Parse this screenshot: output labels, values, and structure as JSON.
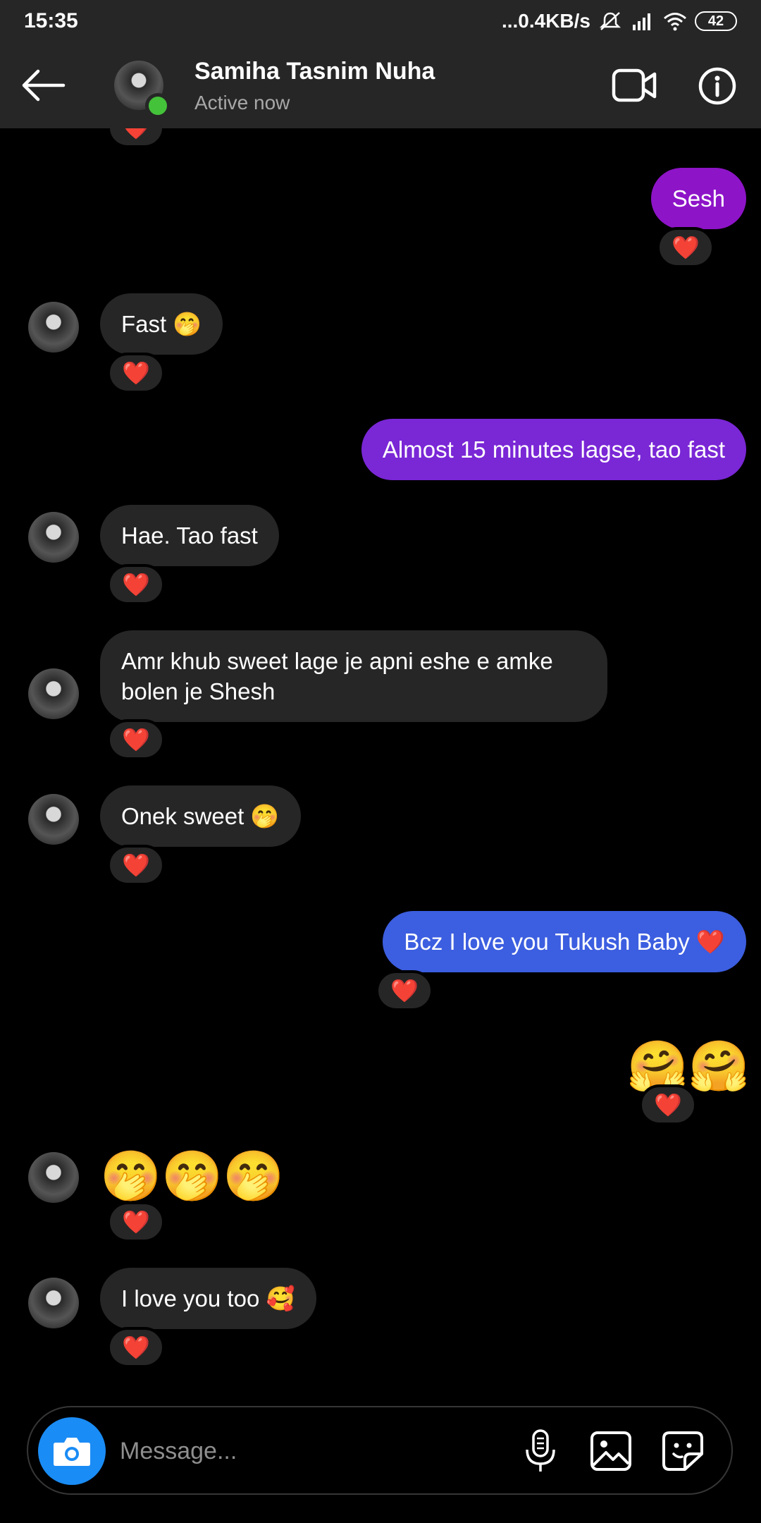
{
  "status_bar": {
    "time": "15:35",
    "network_speed": "...0.4KB/s",
    "battery": "42"
  },
  "header": {
    "back_icon": "arrow-left-icon",
    "contact_name": "Samiha Tasnim Nuha",
    "contact_status": "Active now",
    "video_icon": "video-call-icon",
    "info_icon": "info-icon"
  },
  "messages": [
    {
      "side": "out",
      "text": "Sesh",
      "color": "#8e14c8",
      "reaction": "❤️"
    },
    {
      "side": "in",
      "text": "Fast 🤭",
      "reaction": "❤️"
    },
    {
      "side": "out",
      "text": "Almost 15 minutes lagse, tao fast",
      "color": "#7a27d6"
    },
    {
      "side": "in",
      "text": "Hae. Tao fast",
      "reaction": "❤️"
    },
    {
      "side": "in",
      "text": "Amr khub sweet lage je apni eshe e amke bolen je Shesh",
      "reaction": "❤️"
    },
    {
      "side": "in",
      "text": "Onek sweet 🤭",
      "reaction": "❤️"
    },
    {
      "side": "out",
      "text": "Bcz I love you Tukush Baby ❤️",
      "color": "#3c5ee0",
      "reaction": "❤️"
    },
    {
      "side": "out",
      "text": "🤗🤗",
      "reaction": "❤️"
    },
    {
      "side": "in",
      "text": "🤭🤭🤭",
      "reaction": "❤️"
    },
    {
      "side": "in",
      "text": "I love you too 🥰",
      "reaction": "❤️"
    }
  ],
  "composer": {
    "placeholder": "Message...",
    "camera_icon": "camera-icon",
    "mic_icon": "microphone-icon",
    "gallery_icon": "gallery-icon",
    "sticker_icon": "sticker-icon"
  }
}
